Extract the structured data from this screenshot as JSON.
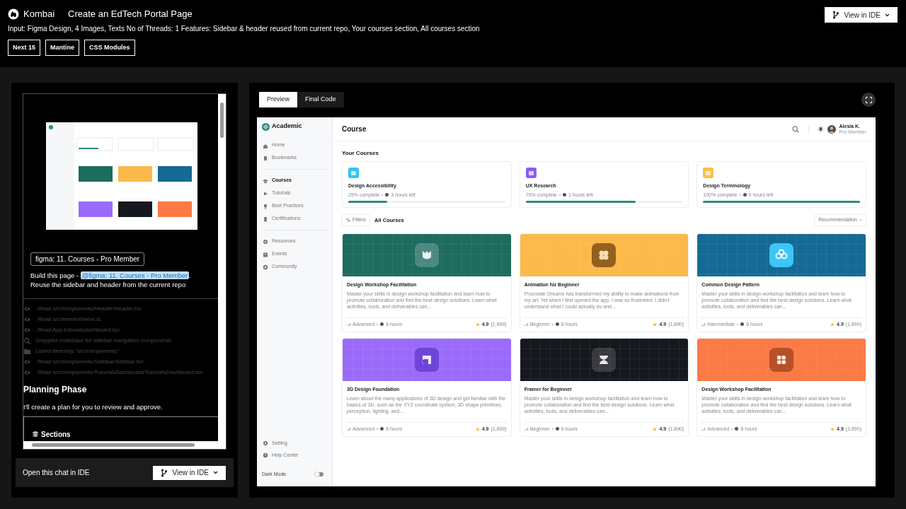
{
  "app": {
    "brand": "Kombai",
    "title": "Create an EdTech Portal Page",
    "view_button": "View in IDE"
  },
  "input_summary": "Input: Figma Design, 4 Images, Texts No of Threads: 1 Features: Sidebar & header reused from current repo, Your courses section, All courses section",
  "tags": [
    "Next 15",
    "Mantine",
    "CSS Modules"
  ],
  "chat": {
    "figma_chip": "figma: 11. Courses - Pro Member",
    "message_before": "Build this page - ",
    "mention": "@figma: 11. Courses - Pro Member",
    "message_after": ". Reuse the sidebar and header from the current repo"
  },
  "activity": [
    {
      "kind": "read",
      "text": "Read src/components/Header/Header.tsx"
    },
    {
      "kind": "read",
      "text": "Read src/theme/theme.ts"
    },
    {
      "kind": "read",
      "text": "Read App.tutorialsdashboard.tsx"
    },
    {
      "kind": "grep",
      "text": "Grepped codebase for sidebar navigation components"
    },
    {
      "kind": "list",
      "text": "Listed directory \"src/components\""
    },
    {
      "kind": "read",
      "text": "Read src/components/Sidebar/Sidebar.tsx"
    },
    {
      "kind": "read",
      "text": "Read src/components/TutorialsDashboard/TutorialsDashboard.tsx"
    }
  ],
  "planning": {
    "heading": "Planning Phase",
    "text": "I'll create a plan for you to review and approve.",
    "section_heading": "Sections"
  },
  "ide_bar": {
    "text": "Open this chat in IDE",
    "button": "View in IDE"
  },
  "preview_tabs": [
    {
      "label": "Preview",
      "selected": true
    },
    {
      "label": "Final Code",
      "selected": false
    }
  ],
  "portal": {
    "brand": "Academic",
    "nav_groups": [
      [
        {
          "label": "Home",
          "selected": false
        },
        {
          "label": "Bookmarks",
          "selected": false
        }
      ],
      [
        {
          "label": "Courses",
          "selected": true
        },
        {
          "label": "Tutorials",
          "selected": false
        },
        {
          "label": "Best Practices",
          "selected": false
        },
        {
          "label": "Certifications",
          "selected": false
        }
      ],
      [
        {
          "label": "Resources",
          "selected": false
        },
        {
          "label": "Events",
          "selected": false
        },
        {
          "label": "Community",
          "selected": false
        }
      ]
    ],
    "footer_nav": [
      "Setting",
      "Help Center"
    ],
    "dark_mode": {
      "label": "Dark Mode",
      "on": false
    },
    "page_title": "Course",
    "user": {
      "name": "Alesia K.",
      "role": "Pro Member"
    },
    "your_courses_heading": "Your Courses",
    "your_courses": [
      {
        "name": "Design Accessibility",
        "progress": "25% complete",
        "time_left": "3 hours left",
        "level": 0.25,
        "color": "#34c4f0"
      },
      {
        "name": "UX Research",
        "progress": "70% complete",
        "time_left": "1 hours left",
        "level": 0.7,
        "color": "#8b5cf6"
      },
      {
        "name": "Design Terminology",
        "progress": "100% complete",
        "time_left": "0 hours left",
        "level": 1,
        "color": "#fbbf4a"
      }
    ],
    "filters_button": "Filters",
    "all_courses_heading": "All Courses",
    "sort": "Recommendation",
    "courses": [
      {
        "title": "Design Workshop Facilitation",
        "description": "Master your skills in design workshop facilitation and learn how to promote collaboration and find the best design solutions. Learn what activities, tools, and deliverables can...",
        "difficulty": "Advanced",
        "duration": "6 hours",
        "rating": "4.9",
        "reviews": "(1,890)",
        "color": "#1e6b5f"
      },
      {
        "title": "Animation for Beginner",
        "description": "Procreate Dreams has transformed my ability to make animations from my art. Yet when I first opened the app, I was so frustrated: I didn't understand what I could actually do and...",
        "difficulty": "Beginner",
        "duration": "6 hours",
        "rating": "4.9",
        "reviews": "(1,890)",
        "color": "#fbb94a"
      },
      {
        "title": "Common Design Pattern",
        "description": "Master your skills in design workshop facilitation and learn how to promote collaboration and find the best design solutions. Learn what activities, tools, and deliverables can...",
        "difficulty": "Intermediate",
        "duration": "6 hours",
        "rating": "4.9",
        "reviews": "(1,890)",
        "color": "#146a94"
      },
      {
        "title": "3D Design Foundation",
        "description": "Learn about the many applications of 3D design and get familiar with the basics of 3D, such as the XYZ coordinate system, 3D shape primitives, perception, lighting, and...",
        "difficulty": "Advanced",
        "duration": "6 hours",
        "rating": "4.9",
        "reviews": "(1,890)",
        "color": "#9a6bfb"
      },
      {
        "title": "Framer for Beginner",
        "description": "Master your skills in design workshop facilitation and learn how to promote collaboration and find the best design solutions. Learn what activities, tools, and deliverables can...",
        "difficulty": "Beginner",
        "duration": "6 hours",
        "rating": "4.9",
        "reviews": "(1,890)",
        "color": "#16181f"
      },
      {
        "title": "Design Workshop Facilitation",
        "description": "Master your skills in design workshop facilitation and learn how to promote collaboration and find the best design solutions. Learn what activities, tools, and deliverables can...",
        "difficulty": "Advanced",
        "duration": "6 hours",
        "rating": "4.9",
        "reviews": "(1,890)",
        "color": "#fb7a45"
      }
    ]
  }
}
